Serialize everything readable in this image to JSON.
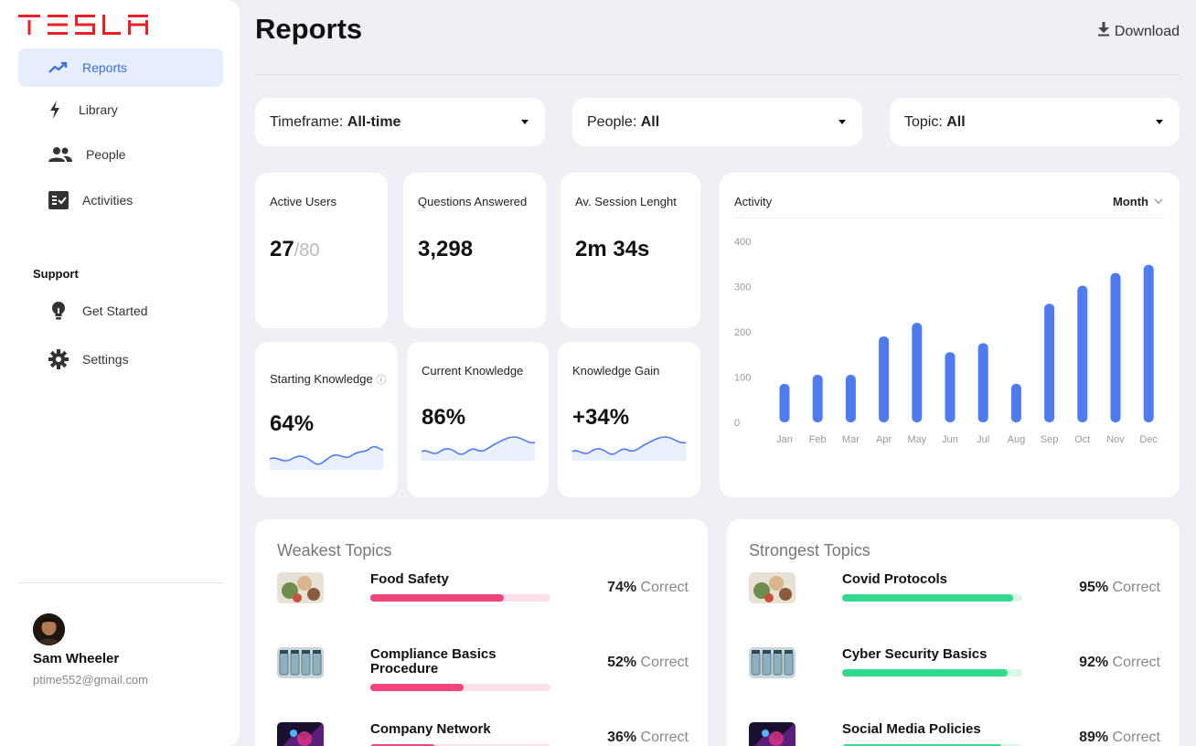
{
  "brand": {
    "logo_text": "TESLA",
    "logo_color": "#e82127"
  },
  "sidebar": {
    "items": [
      {
        "label": "Reports",
        "icon": "trending-up-icon",
        "active": true
      },
      {
        "label": "Library",
        "icon": "lightning-icon",
        "active": false
      },
      {
        "label": "People",
        "icon": "people-icon",
        "active": false
      },
      {
        "label": "Activities",
        "icon": "checklist-icon",
        "active": false
      }
    ],
    "support_title": "Support",
    "support_items": [
      {
        "label": "Get Started",
        "icon": "lightbulb-icon"
      },
      {
        "label": "Settings",
        "icon": "gear-icon"
      }
    ],
    "user": {
      "name": "Sam Wheeler",
      "email": "ptime552@gmail.com"
    }
  },
  "header": {
    "title": "Reports",
    "download_label": "Download"
  },
  "filters": [
    {
      "prefix": "Timeframe:",
      "value": "All-time"
    },
    {
      "prefix": "People:",
      "value": "All"
    },
    {
      "prefix": "Topic:",
      "value": "All"
    }
  ],
  "stats": {
    "active_users": {
      "label": "Active Users",
      "value": "27",
      "total": "/80"
    },
    "questions": {
      "label": "Questions Answered",
      "value": "3,298"
    },
    "session": {
      "label": "Av. Session Lenght",
      "value": "2m 34s"
    },
    "starting": {
      "label": "Starting Knowledge",
      "value": "64%"
    },
    "current": {
      "label": "Current Knowledge",
      "value": "86%"
    },
    "gain": {
      "label": "Knowledge Gain",
      "value": "+34%"
    }
  },
  "activity": {
    "title": "Activity",
    "period": "Month"
  },
  "chart_data": {
    "type": "bar",
    "title": "Activity",
    "categories": [
      "Jan",
      "Feb",
      "Mar",
      "Apr",
      "May",
      "Jun",
      "Jul",
      "Aug",
      "Sep",
      "Oct",
      "Nov",
      "Dec"
    ],
    "values": [
      85,
      105,
      105,
      190,
      220,
      155,
      175,
      85,
      262,
      302,
      330,
      348
    ],
    "ylim": [
      0,
      400
    ],
    "yticks": [
      "400",
      "300",
      "200",
      "100",
      "0"
    ],
    "grid": false,
    "color": "#4e7cf0"
  },
  "weakest": {
    "title": "Weakest Topics",
    "bar_color": "#f0457a",
    "track_color": "#fde0e8",
    "items": [
      {
        "name": "Food Safety",
        "pct": "74%",
        "suffix": "Correct",
        "fill": 0.74,
        "thumb": "food-thumbnail"
      },
      {
        "name": "Compliance Basics Procedure",
        "pct": "52%",
        "suffix": "Correct",
        "fill": 0.52,
        "thumb": "vials-thumbnail"
      },
      {
        "name": "Company Network",
        "pct": "36%",
        "suffix": "Correct",
        "fill": 0.36,
        "thumb": "network-thumbnail"
      }
    ]
  },
  "strongest": {
    "title": "Strongest Topics",
    "bar_color": "#34d990",
    "track_color": "#d8f7e6",
    "items": [
      {
        "name": "Covid Protocols",
        "pct": "95%",
        "suffix": "Correct",
        "fill": 0.95,
        "thumb": "food-thumbnail"
      },
      {
        "name": "Cyber Security Basics",
        "pct": "92%",
        "suffix": "Correct",
        "fill": 0.92,
        "thumb": "vials-thumbnail"
      },
      {
        "name": "Social Media Policies",
        "pct": "89%",
        "suffix": "Correct",
        "fill": 0.89,
        "thumb": "network-thumbnail"
      }
    ]
  }
}
